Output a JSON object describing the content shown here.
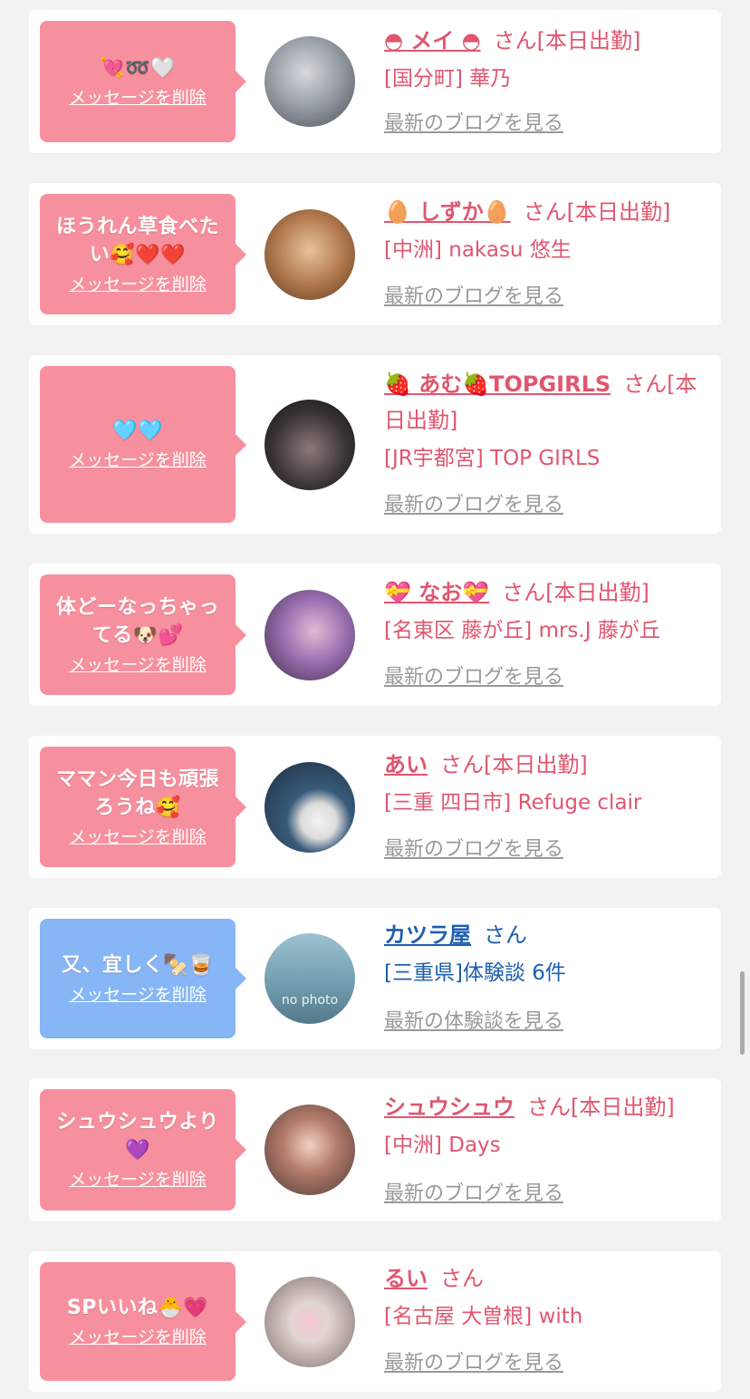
{
  "items": [
    {
      "message": "💘➿🤍",
      "delete_label": "メッセージを削除",
      "name": "◓ メイ ◓",
      "san_status": "さん[本日出勤]",
      "store": "[国分町] 華乃",
      "blog_link": "最新のブログを見る",
      "theme": "pink",
      "avatar_color": "#8a8f96"
    },
    {
      "message": "ほうれん草食べたい🥰❤️❤️",
      "delete_label": "メッセージを削除",
      "name": "🥚 しずか🥚",
      "san_status": "さん[本日出勤]",
      "store": "[中洲] nakasu 悠生",
      "blog_link": "最新のブログを見る",
      "theme": "pink",
      "avatar_color": "#b27a4e"
    },
    {
      "message": "🩵🩵",
      "delete_label": "メッセージを削除",
      "name": "🍓 あむ🍓TOPGIRLS",
      "san_status": "さん[本日出勤]",
      "store": "[JR宇都宮] TOP GIRLS",
      "blog_link": "最新のブログを見る",
      "theme": "pink",
      "avatar_color": "#3a3336"
    },
    {
      "message": "体どーなっちゃってる🐶💕",
      "delete_label": "メッセージを削除",
      "name": "💝 なお💝",
      "san_status": "さん[本日出勤]",
      "store": "[名東区 藤が丘] mrs.J 藤が丘",
      "blog_link": "最新のブログを見る",
      "theme": "pink",
      "avatar_color": "#7d5a8c"
    },
    {
      "message": "ママン今日も頑張ろうね🥰",
      "delete_label": "メッセージを削除",
      "name": "あい",
      "san_status": "さん[本日出勤]",
      "store": "[三重 四日市] Refuge clair",
      "blog_link": "最新のブログを見る",
      "theme": "pink",
      "avatar_color": "#385a7a"
    },
    {
      "message": "又、宜しく🍢🥃",
      "delete_label": "メッセージを削除",
      "name": "カツラ屋",
      "san_status": "さん",
      "store": "[三重県]体験談 6件",
      "blog_link": "最新の体験談を見る",
      "theme": "blue",
      "avatar_color": "#6f9aac",
      "avatar_caption": "no photo"
    },
    {
      "message": "シュウシュウより💜",
      "delete_label": "メッセージを削除",
      "name": "シュウシュウ",
      "san_status": "さん[本日出勤]",
      "store": "[中洲] Days",
      "blog_link": "最新のブログを見る",
      "theme": "pink",
      "avatar_color": "#4a3a34"
    },
    {
      "message": "SPいいね🐣💗",
      "delete_label": "メッセージを削除",
      "name": "るい",
      "san_status": "さん",
      "store": "[名古屋 大曽根] with",
      "blog_link": "最新のブログを見る",
      "theme": "pink",
      "avatar_color": "#cfc6c2"
    }
  ],
  "colors": {
    "pink_bubble": "#f7909e",
    "blue_bubble": "#86b6f5",
    "pink_text": "#e0566f",
    "blue_text": "#1e5fae",
    "link_gray": "#999999"
  }
}
